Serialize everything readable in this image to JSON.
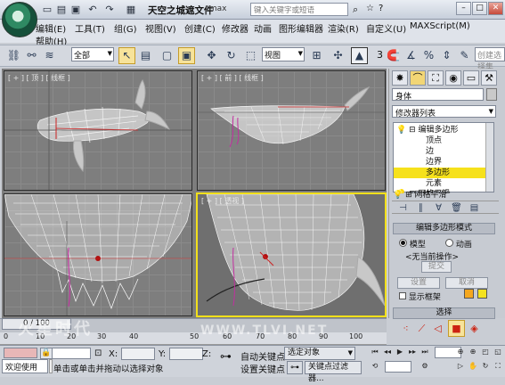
{
  "title_bar": {
    "title": "天空之城遮文件",
    "title_suffix": ".max",
    "search_placeholder": "键入关键字或短语",
    "quick_access_icons": [
      "new-file-icon",
      "open-file-icon",
      "save-file-icon",
      "undo-icon",
      "redo-icon",
      "project-folder-icon"
    ]
  },
  "menu": {
    "items": [
      "编辑(E)",
      "工具(T)",
      "组(G)",
      "视图(V)",
      "创建(C)",
      "修改器",
      "动画",
      "图形编辑器",
      "渲染(R)",
      "自定义(U)",
      "MAXScript(M)"
    ],
    "help": "帮助(H)"
  },
  "toolbar": {
    "selection_filter": "全部",
    "reference_coord": "视图",
    "snap_value": "3",
    "named_selection_placeholder": "创建选择集"
  },
  "viewports": {
    "top": "[ + ] [ 顶 ] [ 线框 ]",
    "front": "[ + ] [ 前 ] [ 线框 ]",
    "left": "",
    "perspective": "[ + ] [ 透视 ]"
  },
  "command_panel": {
    "object_name": "身体",
    "modifier_list": "修改器列表",
    "stack": {
      "top": "编辑多边形",
      "subobjects": [
        "顶点",
        "边",
        "边界",
        "多边形",
        "元素"
      ],
      "selected": "多边形",
      "bottom": "网格平滑"
    },
    "rollout_title": "编辑多边形模式",
    "mode_model": "模型",
    "mode_animate": "动画",
    "last_operation": "<无当前操作>",
    "commit": "提交",
    "settings": "设置",
    "cancel": "取消",
    "show_cage": "显示框架",
    "selection_rollout": "选择"
  },
  "timeline": {
    "frame": "0 / 100",
    "ruler_ticks": [
      "0",
      "10",
      "20",
      "30",
      "40",
      "50",
      "60",
      "70",
      "80",
      "90",
      "100"
    ]
  },
  "status": {
    "x_label": "X:",
    "y_label": "Y:",
    "z_label": "Z:",
    "welcome": "欢迎使用",
    "prompt": "单击或单击并拖动以选择对象",
    "auto_key": "自动关键点",
    "set_key": "设置关键点",
    "key_filter_option": "选定对象",
    "key_filters": "关键点过滤器..."
  },
  "watermark": {
    "left": "火星时代",
    "right": "WWW.TLVI.NET"
  }
}
